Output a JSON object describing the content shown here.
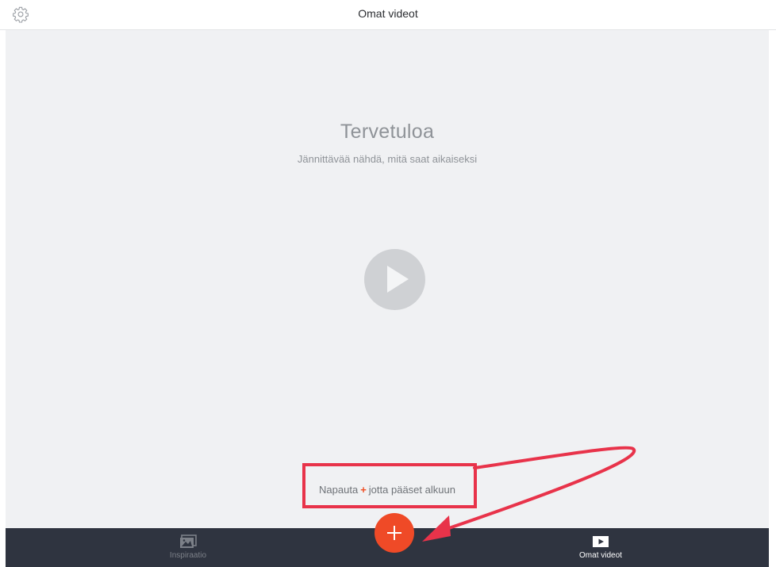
{
  "header": {
    "title": "Omat videot",
    "settings_icon": "gear-icon"
  },
  "welcome": {
    "title": "Tervetuloa",
    "subtitle": "Jännittävää nähdä, mitä saat aikaiseksi",
    "play_icon": "play-icon"
  },
  "hint": {
    "before": "Napauta",
    "plus": "+",
    "after": "jotta pääset alkuun"
  },
  "bottom_nav": {
    "inspiration_label": "Inspiraatio",
    "inspiration_icon": "image-icon",
    "my_videos_label": "Omat videot",
    "my_videos_icon": "video-icon",
    "add_icon": "plus-icon"
  },
  "colors": {
    "accent": "#ef4a27",
    "annotation": "#e8334a",
    "bottom_bar": "#2f3440",
    "content_bg": "#f0f1f3"
  }
}
